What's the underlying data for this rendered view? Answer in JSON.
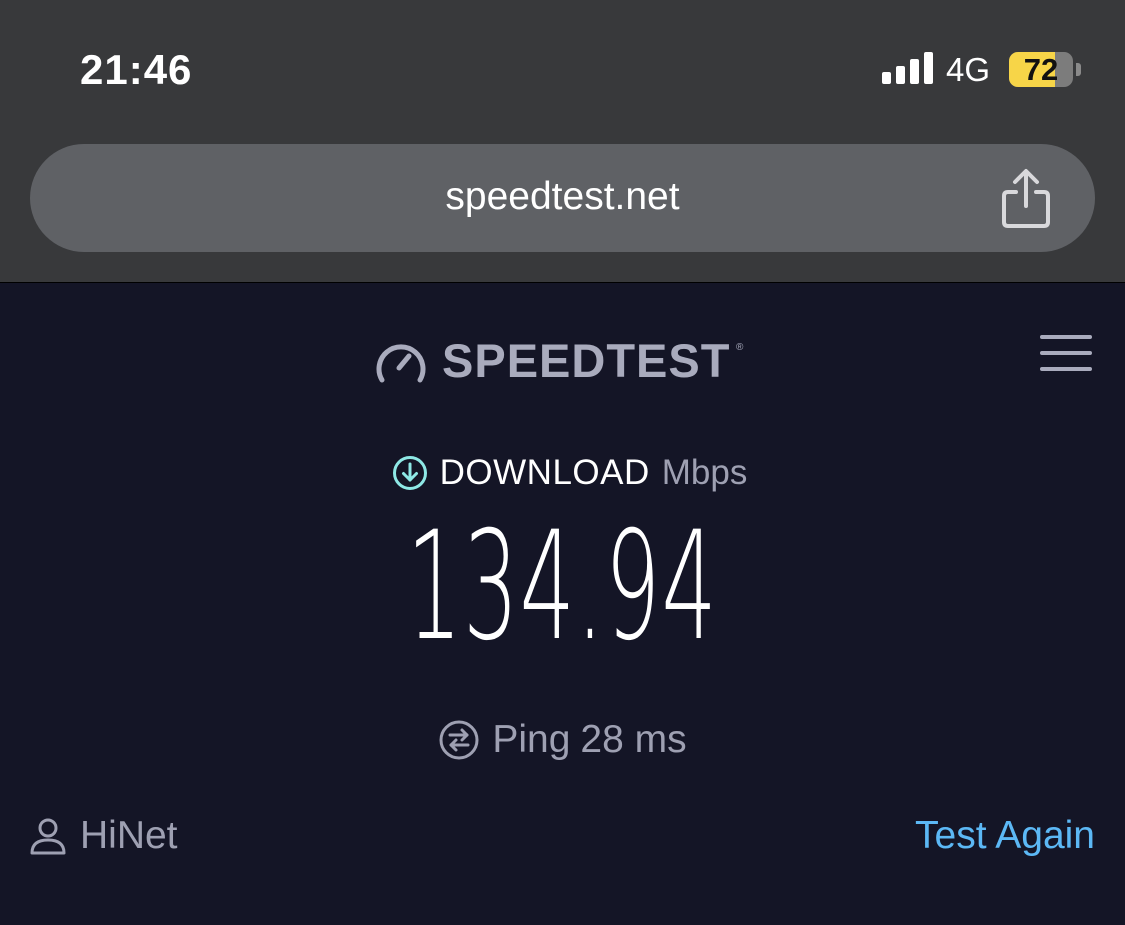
{
  "status_bar": {
    "time": "21:46",
    "signal_icon": "cellular-signal-icon",
    "network": "4G",
    "battery_level": "72",
    "battery_fraction": 0.72,
    "battery_color": "#f7d548"
  },
  "browser": {
    "url": "speedtest.net",
    "share_icon": "share-icon"
  },
  "header": {
    "logo_icon": "speedometer-icon",
    "logo_text": "SPEEDTEST",
    "logo_mark": "®",
    "menu_icon": "hamburger-menu-icon"
  },
  "result": {
    "download_icon": "download-arrow-icon",
    "download_label": "DOWNLOAD",
    "download_unit": "Mbps",
    "download_value": "134.94",
    "ping_icon": "ping-icon",
    "ping_label": "Ping",
    "ping_value": "28 ms"
  },
  "footer": {
    "isp_icon": "user-icon",
    "isp_name": "HiNet",
    "test_again_label": "Test Again"
  },
  "colors": {
    "background": "#141526",
    "chrome": "#38393b",
    "accent_link": "#5cb8f5",
    "download_icon": "#8ee8e6",
    "muted_text": "#9ea0b2"
  }
}
